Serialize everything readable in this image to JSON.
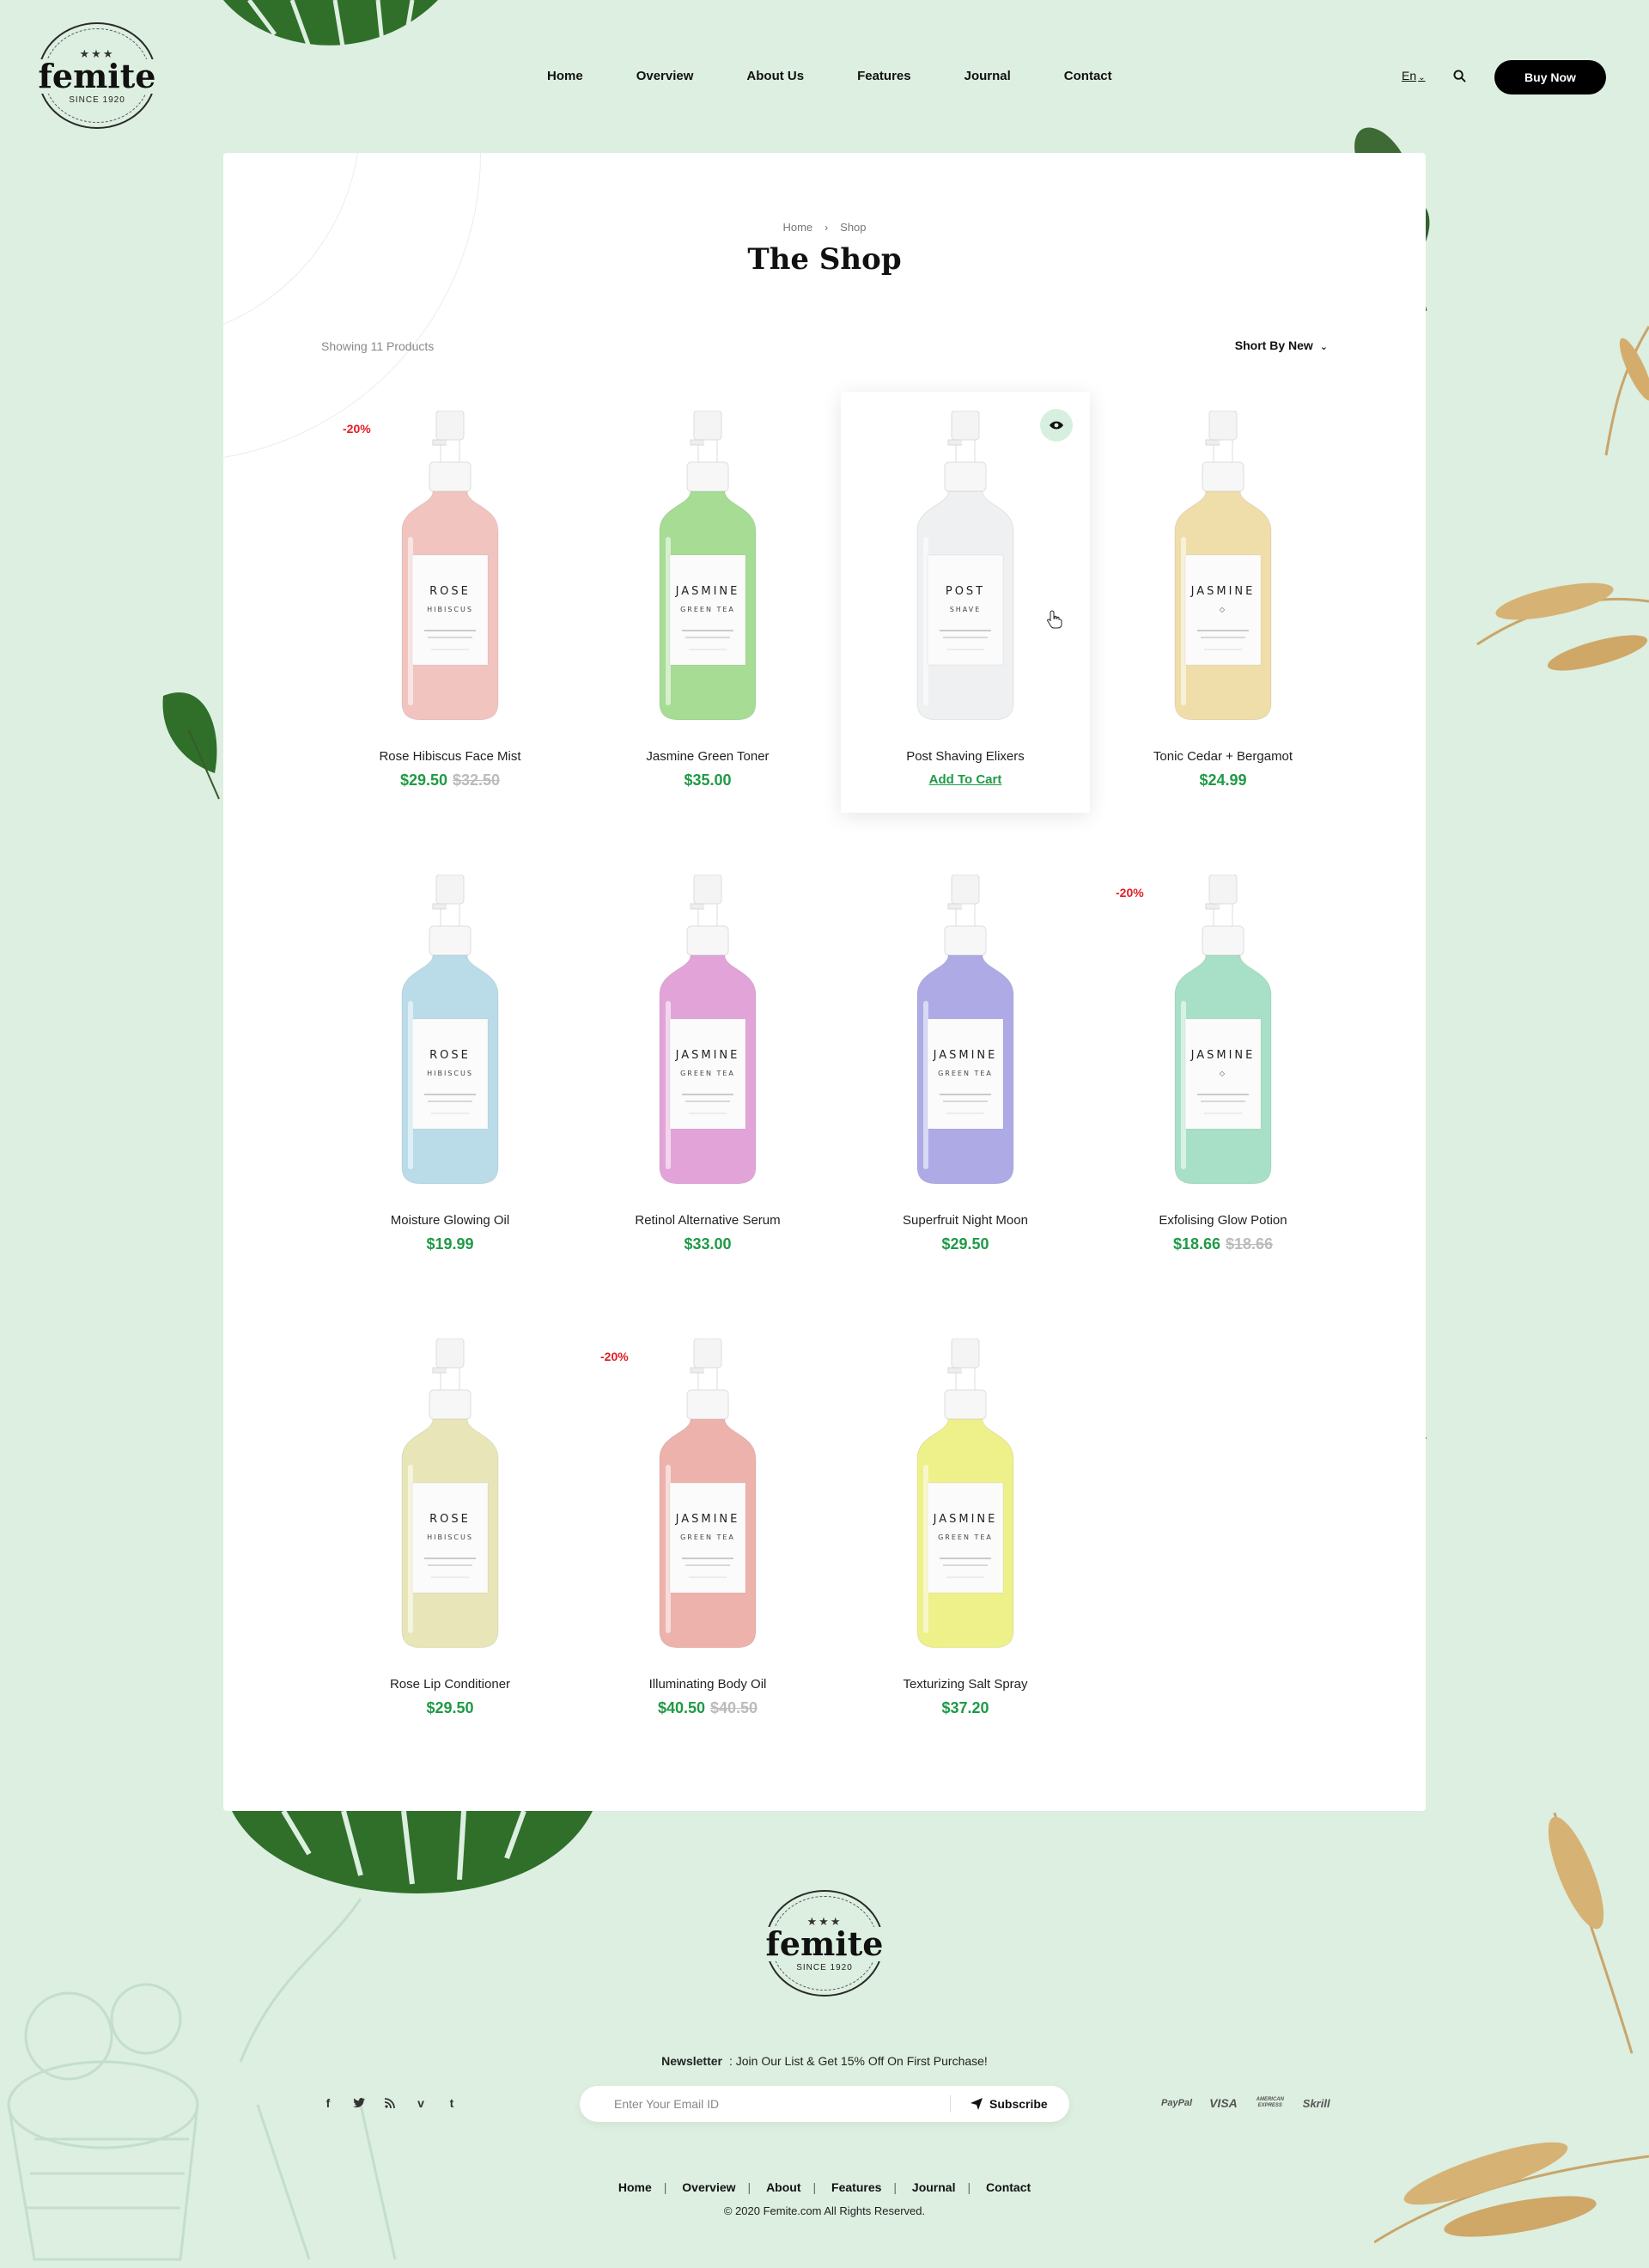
{
  "brand": {
    "name": "femite",
    "since": "SINCE 1920"
  },
  "nav": {
    "items": [
      "Home",
      "Overview",
      "About Us",
      "Features",
      "Journal",
      "Contact"
    ]
  },
  "header": {
    "language": "En",
    "buy_label": "Buy Now"
  },
  "breadcrumb": {
    "home": "Home",
    "current": "Shop"
  },
  "page_title": "The Shop",
  "toolbar": {
    "count_text": "Showing 11 Products",
    "sort_label": "Short By New"
  },
  "products": [
    {
      "name": "Rose Hibiscus Face Mist",
      "price": "$29.50",
      "old_price": "$32.50",
      "badge": "-20%",
      "label": [
        "ROSE",
        "HIBISCUS"
      ],
      "color": "#f2c4c0"
    },
    {
      "name": "Jasmine Green Toner",
      "price": "$35.00",
      "old_price": "",
      "badge": "",
      "label": [
        "JASMINE",
        "GREEN TEA"
      ],
      "color": "#a6dc94"
    },
    {
      "name": "Post Shaving Elixers",
      "price": "",
      "old_price": "",
      "badge": "",
      "label": [
        "POST",
        "SHAVE"
      ],
      "color": "#eef0f1",
      "action": "Add To Cart"
    },
    {
      "name": "Tonic Cedar + Bergamot",
      "price": "$24.99",
      "old_price": "",
      "badge": "",
      "label": [
        "JASMINE",
        "◇"
      ],
      "color": "#f0deaa"
    },
    {
      "name": "Moisture Glowing Oil",
      "price": "$19.99",
      "old_price": "",
      "badge": "",
      "label": [
        "ROSE",
        "HIBISCUS"
      ],
      "color": "#b9dce8"
    },
    {
      "name": "Retinol Alternative Serum",
      "price": "$33.00",
      "old_price": "",
      "badge": "",
      "label": [
        "JASMINE",
        "GREEN TEA"
      ],
      "color": "#e2a4d8"
    },
    {
      "name": "Superfruit Night Moon",
      "price": "$29.50",
      "old_price": "",
      "badge": "",
      "label": [
        "JASMINE",
        "GREEN TEA"
      ],
      "color": "#aeaae6"
    },
    {
      "name": "Exfolising Glow Potion",
      "price": "$18.66",
      "old_price": "$18.66",
      "badge": "-20%",
      "label": [
        "JASMINE",
        "◇"
      ],
      "color": "#a7e0c6"
    },
    {
      "name": "Rose Lip Conditioner",
      "price": "$29.50",
      "old_price": "",
      "badge": "",
      "label": [
        "ROSE",
        "HIBISCUS"
      ],
      "color": "#e8e6b8"
    },
    {
      "name": "Illuminating Body Oil",
      "price": "$40.50",
      "old_price": "$40.50",
      "badge": "-20%",
      "label": [
        "JASMINE",
        "GREEN TEA"
      ],
      "color": "#eeb2ac"
    },
    {
      "name": "Texturizing Salt Spray",
      "price": "$37.20",
      "old_price": "",
      "badge": "",
      "label": [
        "JASMINE",
        "GREEN TEA"
      ],
      "color": "#eef08a"
    }
  ],
  "footer": {
    "newsletter_title": "Newsletter",
    "newsletter_text": ":  Join Our List & Get 15% Off On First Purchase!",
    "email_placeholder": "Enter Your Email ID",
    "subscribe_label": "Subscribe",
    "socials": [
      "f",
      "t",
      "rss",
      "v",
      "t"
    ],
    "payments": [
      "PayPal",
      "VISA",
      "AMERICAN EXPRESS",
      "Skrill"
    ],
    "links": [
      "Home",
      "Overview",
      "About",
      "Features",
      "Journal",
      "Contact"
    ],
    "copyright": "© 2020 Femite.com All Rights Reserved."
  },
  "colors": {
    "background": "#dcefe0",
    "accent_green": "#1f9a46",
    "sale_red": "#e31b23",
    "button_black": "#000000"
  }
}
